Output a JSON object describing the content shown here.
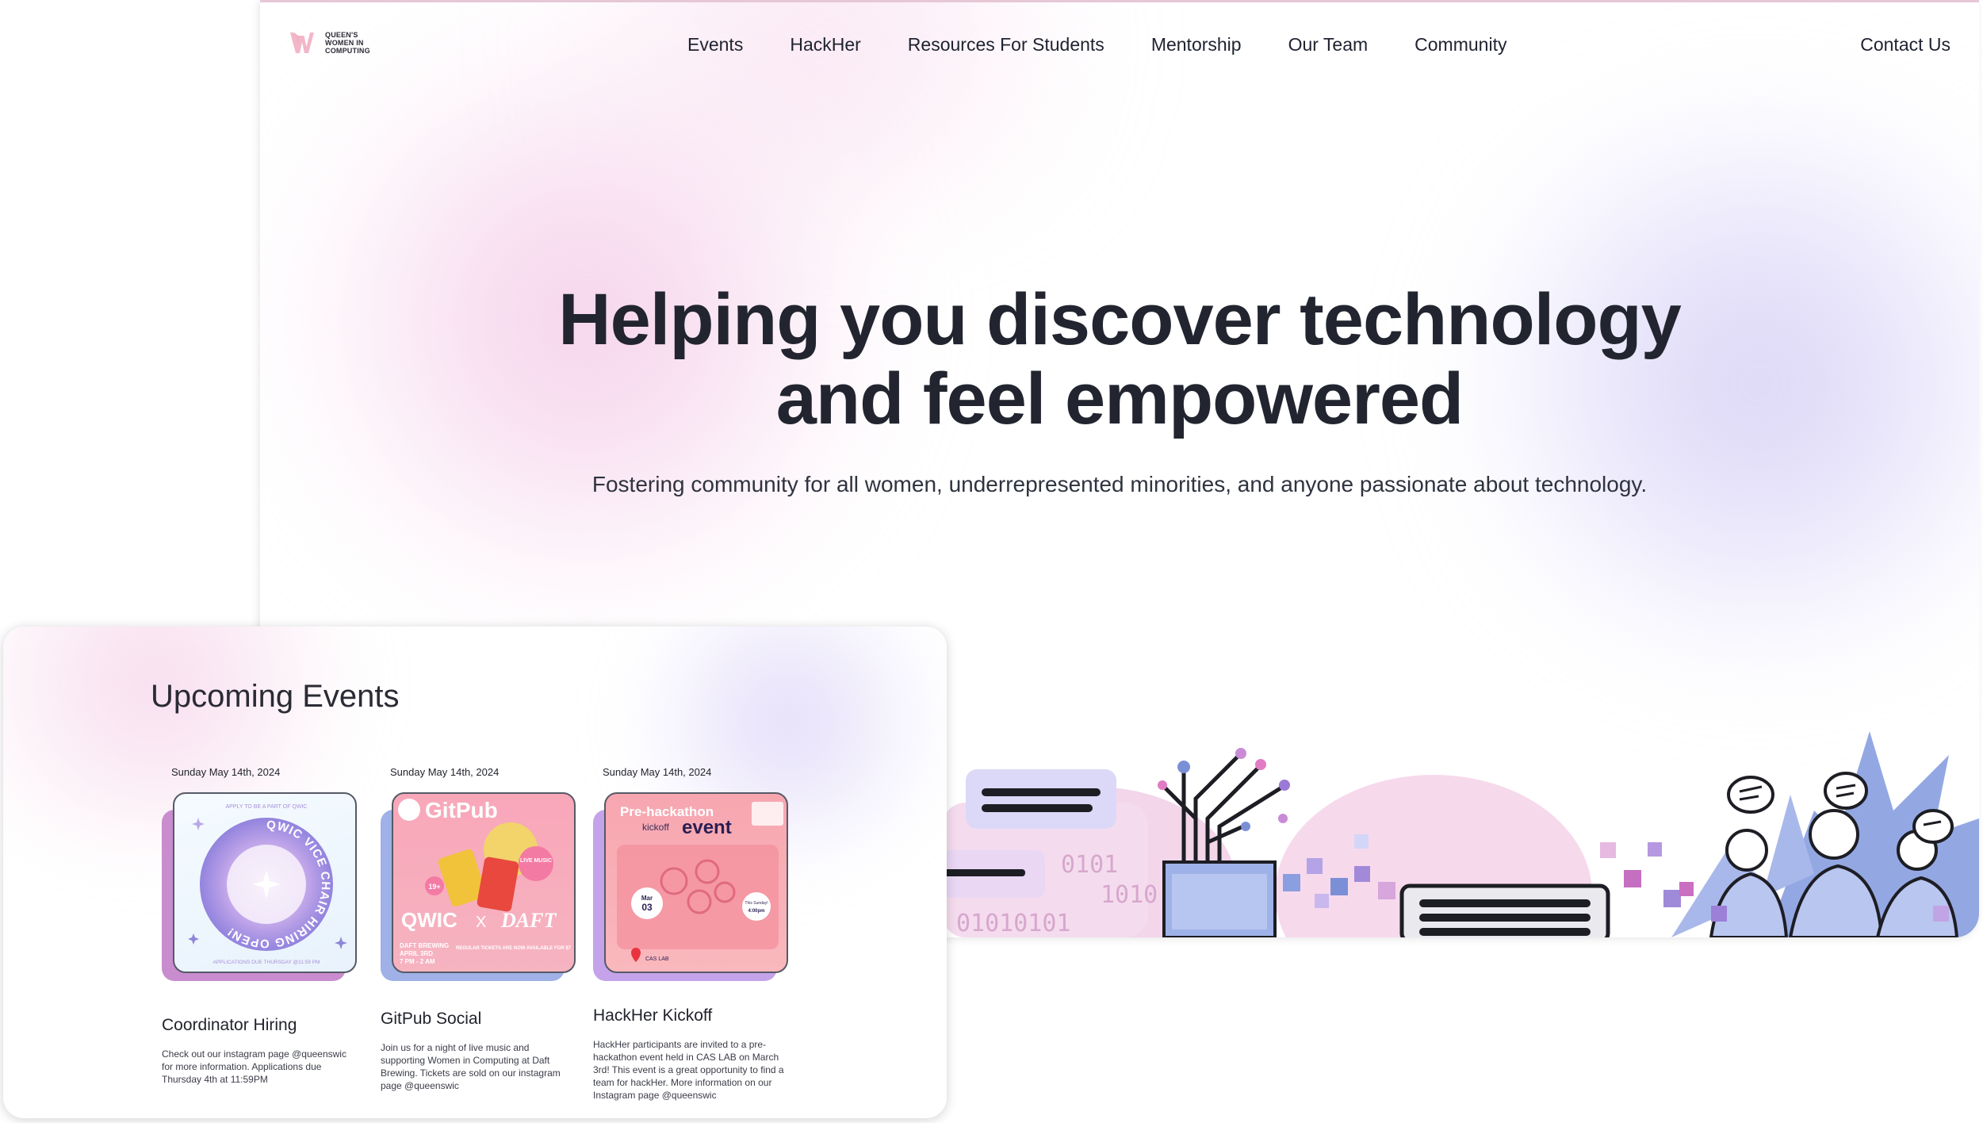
{
  "logo": {
    "lines": [
      "QUEEN'S",
      "WOMEN IN",
      "COMPUTING"
    ]
  },
  "nav": {
    "links": [
      "Events",
      "HackHer",
      "Resources For Students",
      "Mentorship",
      "Our Team",
      "Community"
    ],
    "contact": "Contact Us"
  },
  "hero": {
    "title_line1": "Helping you discover technology",
    "title_line2": "and feel empowered",
    "subtitle": "Fostering community for all women, underrepresented minorities, and anyone passionate about technology."
  },
  "events": {
    "heading": "Upcoming Events",
    "items": [
      {
        "date": "Sunday May 14th, 2024",
        "title": "Coordinator Hiring",
        "description": "Check out our instagram page @queenswic for more information. Applications due Thursday 4th at 11:59PM",
        "poster": {
          "top_text": "APPLY TO BE A PART OF QWIC",
          "ring_text": "QWIC VICE CHAIR HIRING OPEN!",
          "bottom_text": "APPLICATIONS DUE THURSDAY @11:59 PM"
        }
      },
      {
        "date": "Sunday May 14th, 2024",
        "title": "GitPub Social",
        "description": "Join us for a night of live music and supporting Women in Computing at Daft Brewing. Tickets are sold on our instagram page @queenswic",
        "poster": {
          "brand": "GitPub",
          "badge": "19+",
          "live": "LIVE MUSIC",
          "collab_left": "QWIC",
          "collab_x": "X",
          "collab_right": "DAFT",
          "venue": "DAFT BREWING",
          "when": "APRIL 3RD",
          "time": "7 PM - 2 AM",
          "tickets": "REGULAR TICKETS ARE NOW AVAILABLE FOR $7"
        }
      },
      {
        "date": "Sunday May 14th, 2024",
        "title": "HackHer Kickoff",
        "description": "HackHer participants are invited to a pre-hackathon event held in CAS LAB on March 3rd! This event is a great opportunity to find a team for hackHer. More information on our Instagram page @queenswic",
        "poster": {
          "line1": "Pre-hackathon",
          "line2": "kickoff",
          "line3": "event",
          "month": "Mar",
          "day": "03",
          "day_name": "This Sunday!",
          "time": "4:00pm",
          "location": "CAS LAB"
        }
      }
    ]
  },
  "illustration": {
    "binary_1": "0101",
    "binary_2": "1010",
    "binary_3": "01010101"
  }
}
